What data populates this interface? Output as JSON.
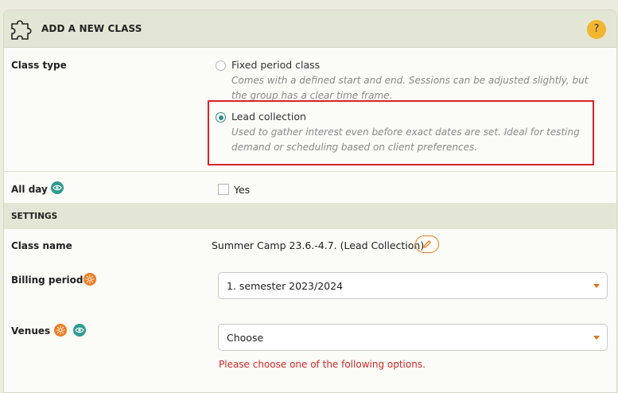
{
  "header": {
    "title": "ADD A NEW CLASS",
    "help_label": "?",
    "icon": "puzzle-icon"
  },
  "class_type": {
    "label": "Class type",
    "options": [
      {
        "title": "Fixed period class",
        "description": "Comes with a defined start and end. Sessions can be adjusted slightly, but the group has a clear time frame.",
        "desc_line1": "Comes with a defined start and end. Sessions can be adjusted slightly, but",
        "desc_line2": "the group has a clear time frame.",
        "selected": false
      },
      {
        "title": "Lead collection",
        "description": "Used to gather interest even before exact dates are set. Ideal for testing demand or scheduling based on client preferences.",
        "desc_line1": "Used to gather interest even before exact dates are set. Ideal for testing",
        "desc_line2": "demand or scheduling based on client preferences.",
        "selected": true
      }
    ]
  },
  "all_day": {
    "label": "All day",
    "checkbox_label": "Yes",
    "checked": false
  },
  "settings": {
    "section_title": "SETTINGS",
    "class_name": {
      "label": "Class name",
      "value": "Summer Camp 23.6.-4.7. (Lead Collection)"
    },
    "billing_period": {
      "label": "Billing period",
      "selected": "1. semester 2023/2024"
    },
    "venues": {
      "label": "Venues",
      "selected": "Choose",
      "error": "Please choose one of the following options."
    }
  },
  "colors": {
    "accent_teal": "#2e9a90",
    "accent_orange": "#ee7a1f",
    "error_red": "#d42a2a",
    "help_yellow": "#f3b630",
    "highlight_red": "#d8232a"
  }
}
